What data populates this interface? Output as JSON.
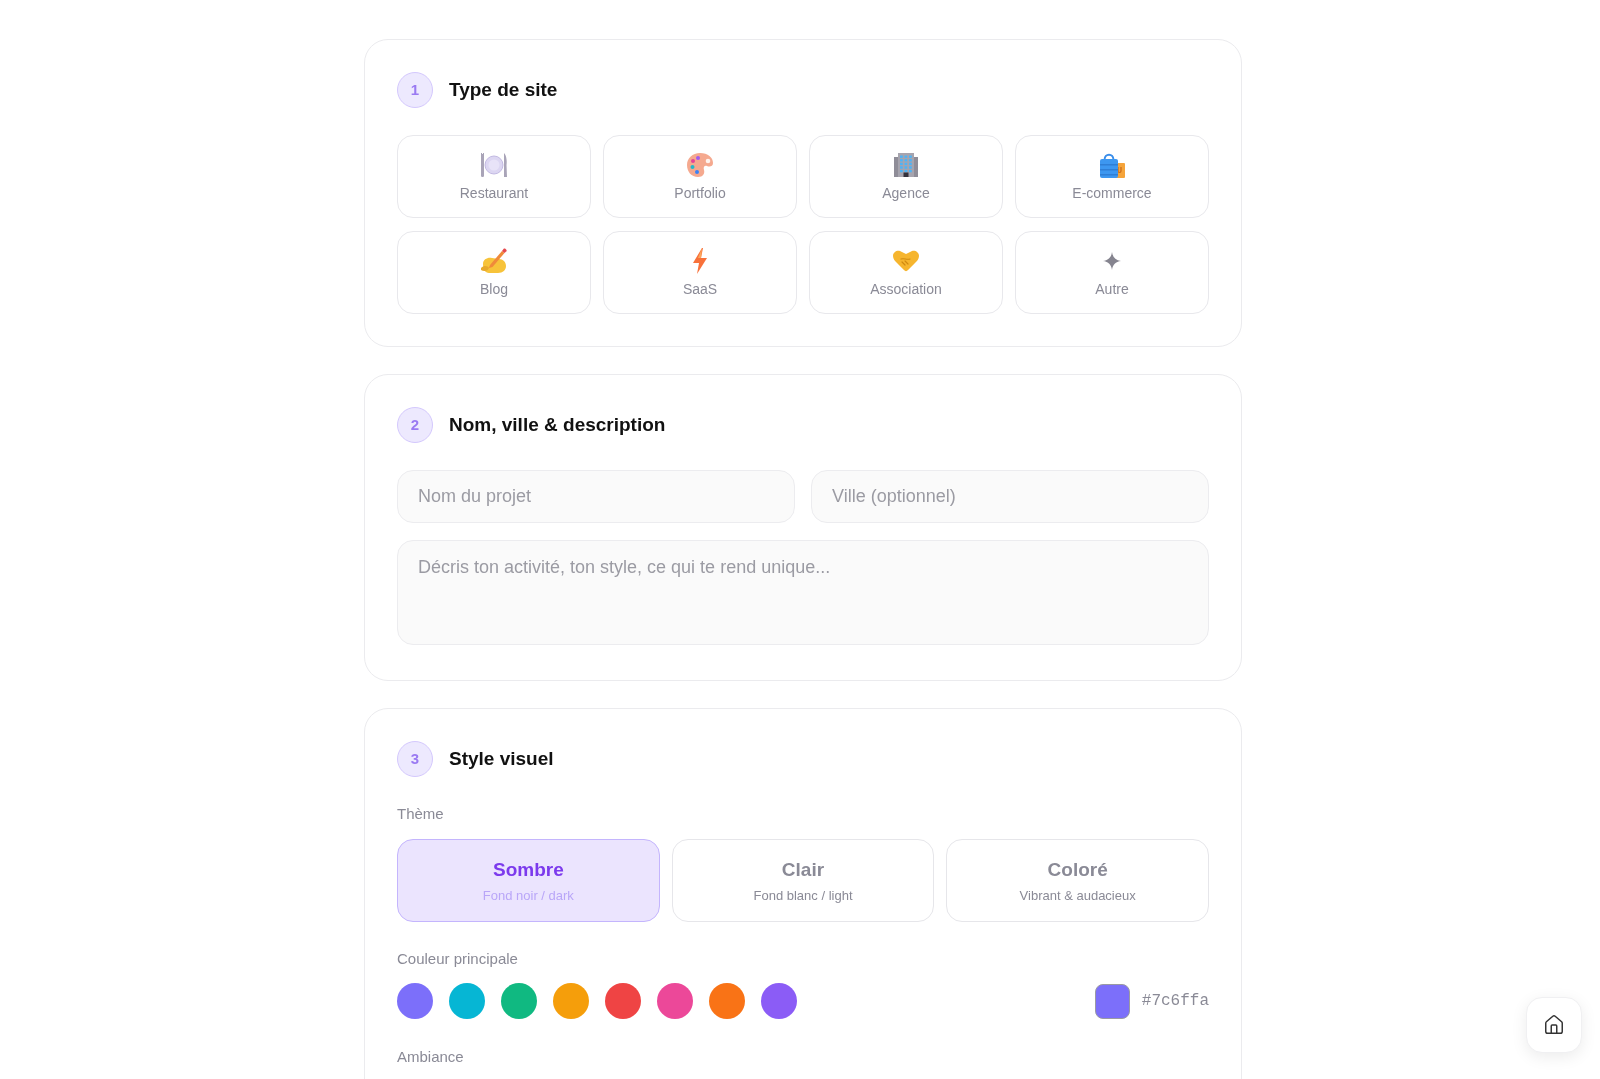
{
  "sections": [
    {
      "kind": "site_types",
      "number": "1",
      "title": "Type de site",
      "options": [
        {
          "label": "Restaurant",
          "selected": false
        },
        {
          "label": "Portfolio",
          "selected": false
        },
        {
          "label": "Agence",
          "selected": false
        },
        {
          "label": "E-commerce",
          "selected": false
        },
        {
          "label": "Blog",
          "selected": false
        },
        {
          "label": "SaaS",
          "selected": false
        },
        {
          "label": "Association",
          "selected": false
        },
        {
          "label": "Autre",
          "selected": false
        }
      ]
    },
    {
      "kind": "details",
      "number": "2",
      "title": "Nom, ville & description",
      "fields": [
        {
          "kind": "input",
          "placeholder": "Nom du projet"
        },
        {
          "kind": "input",
          "placeholder": "Ville (optionnel)"
        },
        {
          "kind": "textarea",
          "placeholder": "Décris ton activité, ton style, ce qui te rend unique..."
        }
      ]
    },
    {
      "kind": "style",
      "number": "3",
      "title": "Style visuel",
      "theme": {
        "label": "Thème",
        "options": [
          {
            "title": "Sombre",
            "subtitle": "Fond noir / dark",
            "selected": true
          },
          {
            "title": "Clair",
            "subtitle": "Fond blanc / light",
            "selected": false
          },
          {
            "title": "Coloré",
            "subtitle": "Vibrant & audacieux",
            "selected": false
          }
        ]
      },
      "main_color": {
        "label": "Couleur principale",
        "swatches": [
          {
            "color": "#7c6ffa",
            "selected": false
          },
          {
            "color": "#06b6d4",
            "selected": false
          },
          {
            "color": "#10b981",
            "selected": false
          },
          {
            "color": "#f59e0b",
            "selected": false
          },
          {
            "color": "#ef4444",
            "selected": false
          },
          {
            "color": "#ec4899",
            "selected": false
          },
          {
            "color": "#f97316",
            "selected": false
          },
          {
            "color": "#8b5cf6",
            "selected": false
          }
        ],
        "custom": {
          "color": "#7c6ffa",
          "value": "#7c6ffa"
        }
      },
      "ambiance": {
        "label": "Ambiance"
      }
    }
  ]
}
